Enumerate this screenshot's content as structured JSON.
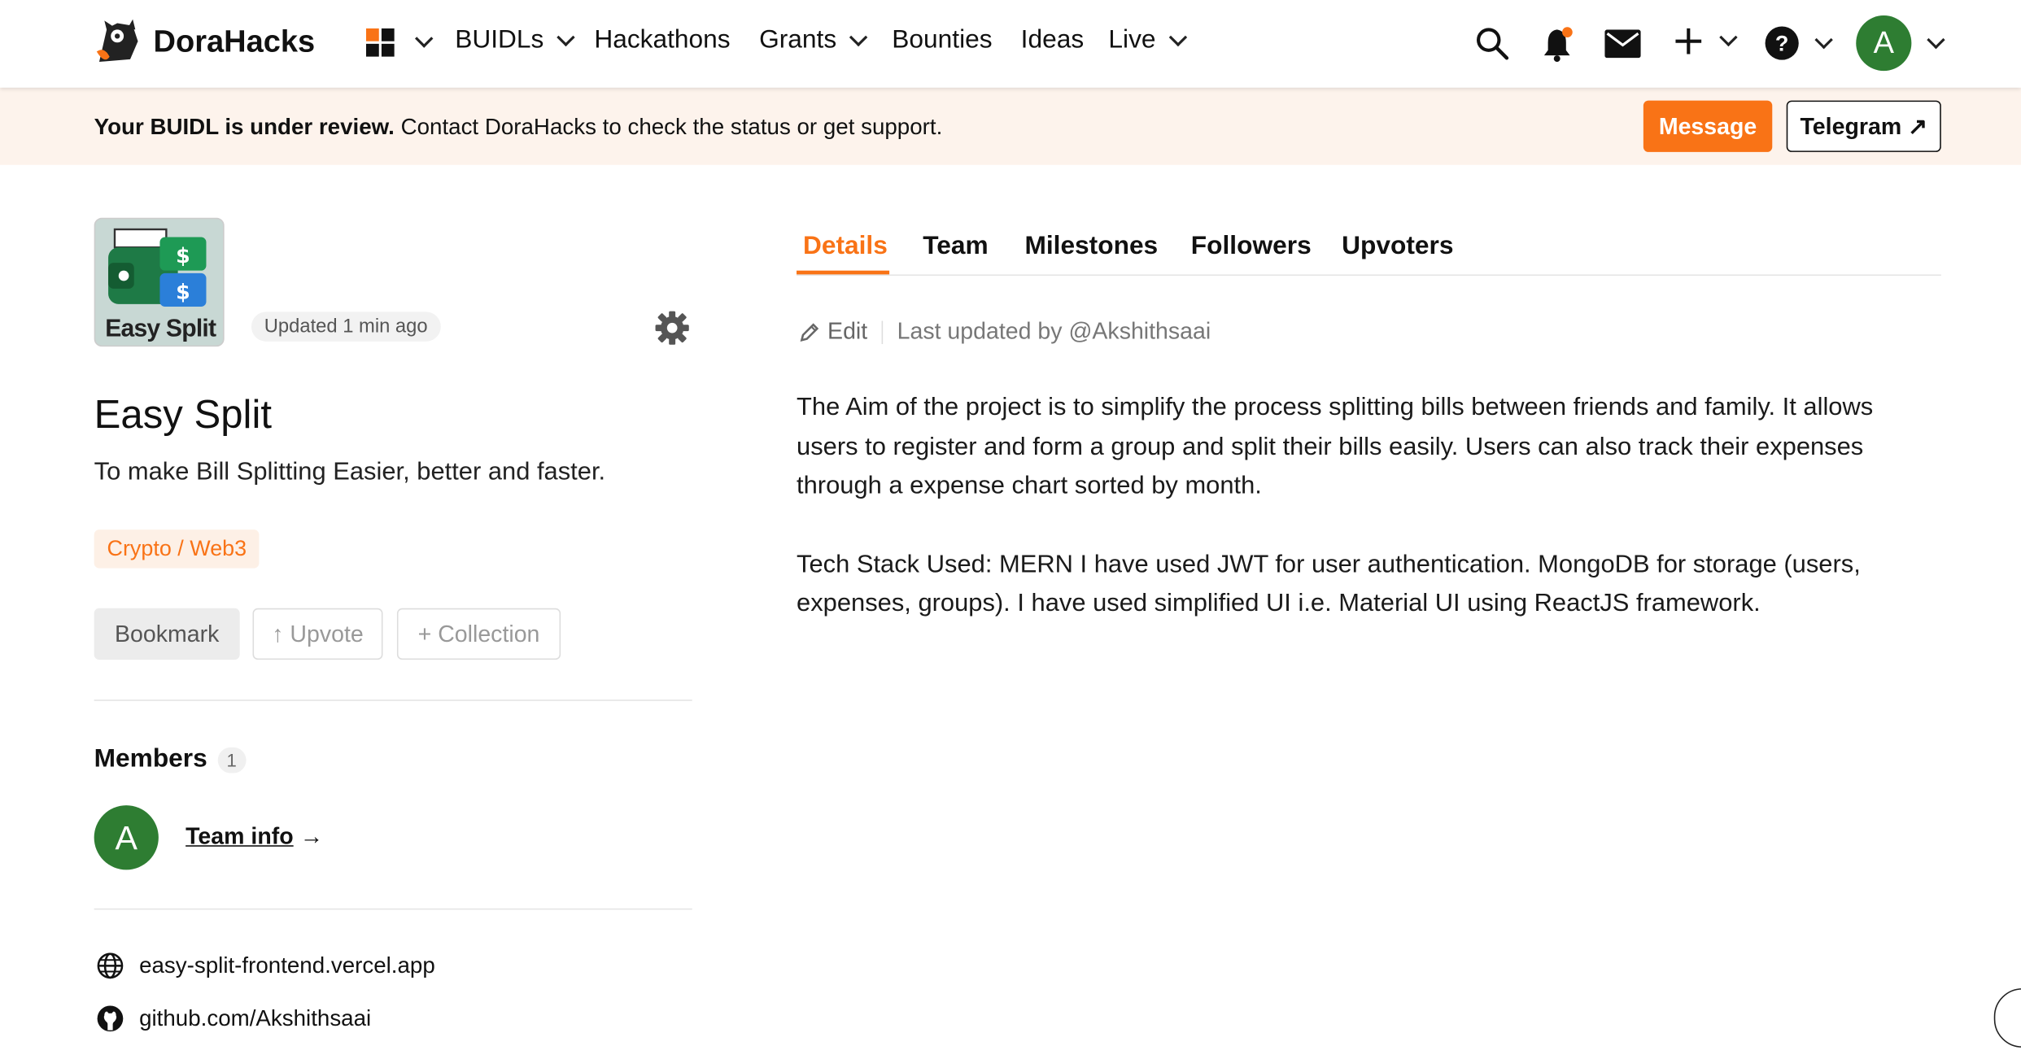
{
  "header": {
    "brand": "DoraHacks",
    "nav": [
      "BUIDLs",
      "Hackathons",
      "Grants",
      "Bounties",
      "Ideas",
      "Live"
    ],
    "avatar_letter": "A"
  },
  "banner": {
    "bold": "Your BUIDL is under review.",
    "text": " Contact DoraHacks to check the status or get support.",
    "message_label": "Message",
    "telegram_label": "Telegram ↗"
  },
  "project": {
    "logo_text": "Easy Split",
    "updated": "Updated 1 min ago",
    "title": "Easy Split",
    "tagline": "To make Bill Splitting Easier, better and faster.",
    "tag": "Crypto / Web3",
    "buttons": {
      "bookmark": "Bookmark",
      "upvote": "↑ Upvote",
      "collection": "+ Collection"
    }
  },
  "members": {
    "title": "Members",
    "count": "1",
    "avatar_letter": "A",
    "team_info": "Team info",
    "arrow": "→"
  },
  "links": {
    "website": "easy-split-frontend.vercel.app",
    "github": "github.com/Akshithsaai"
  },
  "tabs": [
    "Details",
    "Team",
    "Milestones",
    "Followers",
    "Upvoters"
  ],
  "details": {
    "edit": "Edit",
    "last_updated": "Last updated by @Akshithsaai",
    "para1": "The Aim of the project is to simplify the process splitting bills between friends and family. It allows users to register and form a group and split their bills easily. Users can also track their expenses through a expense chart sorted by month.",
    "para2": "Tech Stack Used: MERN I have used JWT for user authentication. MongoDB for storage (users, expenses, groups). I have used simplified UI i.e. Material UI using ReactJS framework."
  },
  "colors": {
    "accent": "#f97316",
    "avatar": "#2e7d32",
    "banner_bg": "#fdf3ec"
  }
}
